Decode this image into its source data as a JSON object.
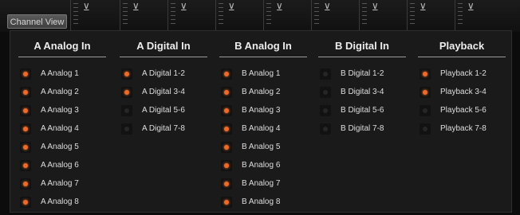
{
  "header": {
    "channel_view_label": "Channel View"
  },
  "columns": [
    {
      "title": "A Analog In",
      "items": [
        {
          "label": "A Analog 1",
          "on": true
        },
        {
          "label": "A Analog 2",
          "on": true
        },
        {
          "label": "A Analog 3",
          "on": true
        },
        {
          "label": "A Analog 4",
          "on": true
        },
        {
          "label": "A Analog 5",
          "on": true
        },
        {
          "label": "A Analog 6",
          "on": true
        },
        {
          "label": "A Analog 7",
          "on": true
        },
        {
          "label": "A Analog 8",
          "on": true
        }
      ]
    },
    {
      "title": "A Digital In",
      "items": [
        {
          "label": "A Digital 1-2",
          "on": true
        },
        {
          "label": "A Digital 3-4",
          "on": true
        },
        {
          "label": "A Digital 5-6",
          "on": false
        },
        {
          "label": "A Digital 7-8",
          "on": false
        }
      ]
    },
    {
      "title": "B Analog In",
      "items": [
        {
          "label": "B Analog 1",
          "on": true
        },
        {
          "label": "B Analog 2",
          "on": true
        },
        {
          "label": "B Analog 3",
          "on": true
        },
        {
          "label": "B Analog 4",
          "on": true
        },
        {
          "label": "B Analog 5",
          "on": true
        },
        {
          "label": "B Analog 6",
          "on": true
        },
        {
          "label": "B Analog 7",
          "on": true
        },
        {
          "label": "B Analog 8",
          "on": true
        }
      ]
    },
    {
      "title": "B Digital In",
      "items": [
        {
          "label": "B Digital 1-2",
          "on": false
        },
        {
          "label": "B Digital 3-4",
          "on": false
        },
        {
          "label": "B Digital 5-6",
          "on": false
        },
        {
          "label": "B Digital 7-8",
          "on": false
        }
      ]
    },
    {
      "title": "Playback",
      "items": [
        {
          "label": "Playback 1-2",
          "on": true
        },
        {
          "label": "Playback 3-4",
          "on": true
        },
        {
          "label": "Playback 5-6",
          "on": false
        },
        {
          "label": "Playback 7-8",
          "on": false
        }
      ]
    }
  ],
  "colors": {
    "led_on": "#ee6a2a",
    "led_off": "#262626"
  },
  "icons": {
    "channel_knob": "tuner-knob-icon",
    "led": "led-indicator-icon"
  }
}
